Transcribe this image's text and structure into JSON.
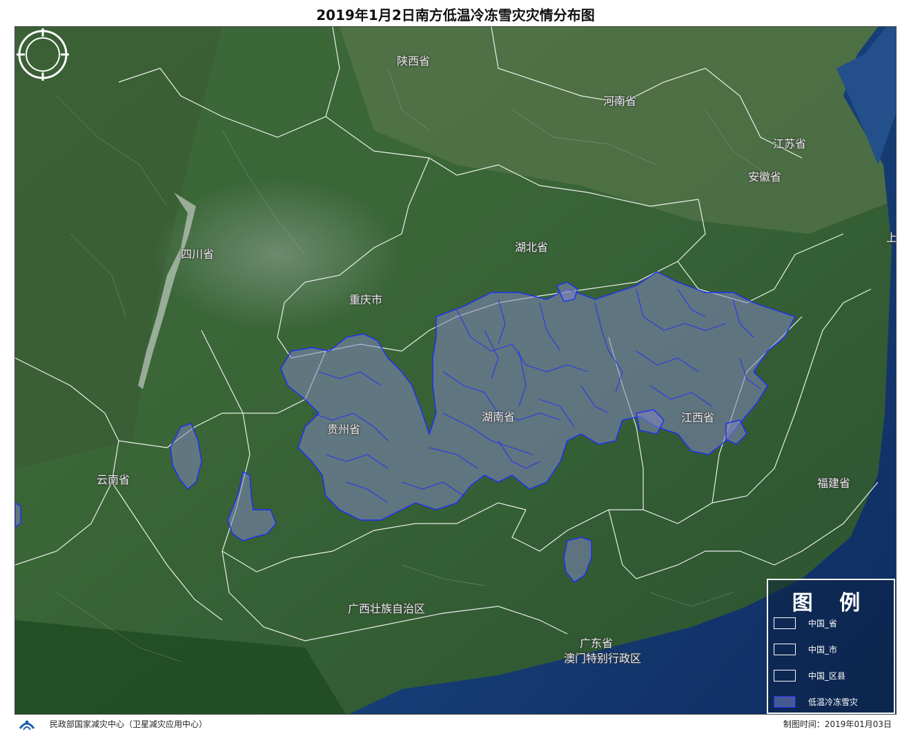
{
  "title": "2019年1月2日南方低温冷冻雪灾灾情分布图",
  "provinces": {
    "shaanxi": "陕西省",
    "henan": "河南省",
    "jiangsu": "江苏省",
    "anhui": "安徽省",
    "sichuan": "四川省",
    "hubei": "湖北省",
    "chongqing": "重庆市",
    "guizhou": "贵州省",
    "hunan": "湖南省",
    "jiangxi": "江西省",
    "yunnan": "云南省",
    "fujian": "福建省",
    "guangxi": "广西壮族自治区",
    "guangdong": "广东省",
    "macau": "澳门特别行政区",
    "shanghai_partial": "上"
  },
  "legend": {
    "title": "图 例",
    "items": [
      {
        "label": "中国_省"
      },
      {
        "label": "中国_市"
      },
      {
        "label": "中国_区县"
      },
      {
        "label": "低温冷冻雪灾"
      }
    ]
  },
  "footer": {
    "org": "民政部国家减灾中心（卫星减灾应用中心）",
    "made_time": "制图时间：2019年01月03日"
  },
  "colors": {
    "disaster_outline": "#1b2cff",
    "boundary": "#ffffff"
  }
}
